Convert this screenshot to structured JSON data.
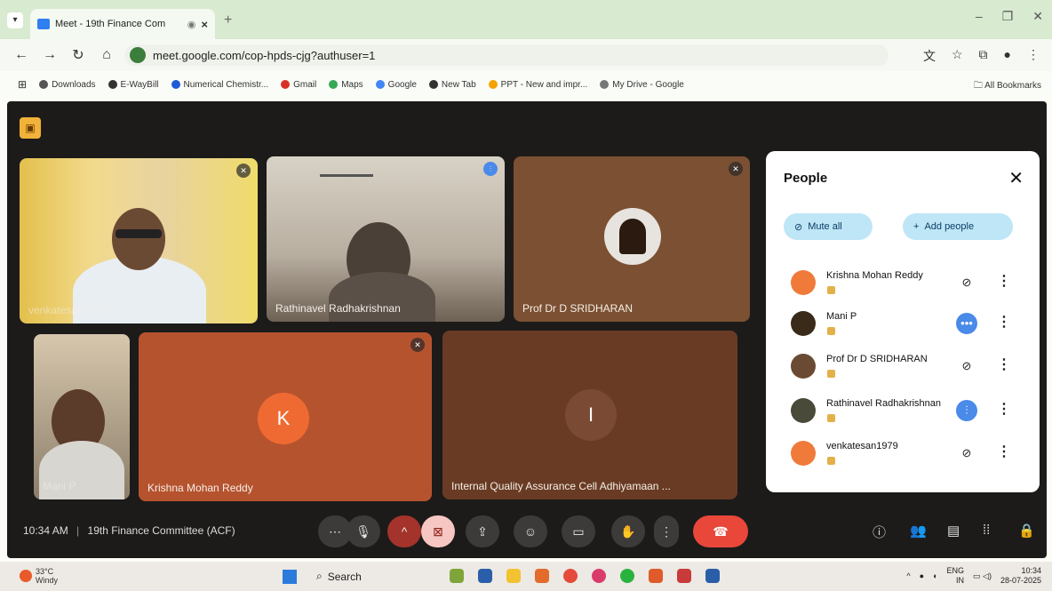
{
  "browser": {
    "tab_title": "Meet - 19th Finance Com",
    "url": "meet.google.com/cop-hpds-cjg?authuser=1",
    "bookmarks": [
      {
        "label": "Downloads",
        "color": "#555555"
      },
      {
        "label": "E-WayBill",
        "color": "#333333"
      },
      {
        "label": "Numerical Chemistr...",
        "color": "#1e5bd6"
      },
      {
        "label": "Gmail",
        "color": "#d93025"
      },
      {
        "label": "Maps",
        "color": "#34a853"
      },
      {
        "label": "Google",
        "color": "#4285f4"
      },
      {
        "label": "New Tab",
        "color": "#333333"
      },
      {
        "label": "PPT - New and impr...",
        "color": "#f4a300"
      },
      {
        "label": "My Drive - Google",
        "color": "#777777"
      }
    ],
    "all_bookmarks": "All Bookmarks"
  },
  "meeting": {
    "time": "10:34 AM",
    "title": "19th Finance Committee (ACF)",
    "tiles": [
      {
        "name": "venkatesan1979"
      },
      {
        "name": "Rathinavel Radhakrishnan"
      },
      {
        "name": "Prof Dr D SRIDHARAN"
      },
      {
        "name": "Mani P"
      },
      {
        "name": "Krishna Mohan Reddy",
        "initial": "K"
      },
      {
        "name": "Internal Quality Assurance Cell Adhiyamaan ...",
        "initial": "I"
      }
    ]
  },
  "people_panel": {
    "title": "People",
    "mute_all": "Mute all",
    "add_people": "Add people",
    "participants": [
      {
        "name": "Krishna Mohan Reddy",
        "avatar_color": "#f07a3a",
        "state": "muted"
      },
      {
        "name": "Mani P",
        "avatar_color": "#3a2a1a",
        "state": "more"
      },
      {
        "name": "Prof Dr D SRIDHARAN",
        "avatar_color": "#6a4a32",
        "state": "muted"
      },
      {
        "name": "Rathinavel Radhakrishnan",
        "avatar_color": "#4a4a3a",
        "state": "speaking"
      },
      {
        "name": "venkatesan1979",
        "avatar_color": "#f07a3a",
        "state": "muted"
      }
    ]
  },
  "taskbar": {
    "weather": "33°C",
    "weather_sub": "Windy",
    "search": "Search",
    "lang": "ENG",
    "region": "IN",
    "clock_time": "10:34",
    "clock_date": "28-07-2025"
  },
  "colors": {
    "meet_bg": "#1c1b1a",
    "end_call": "#e8473a",
    "accent_blue": "#4a8ae8"
  }
}
